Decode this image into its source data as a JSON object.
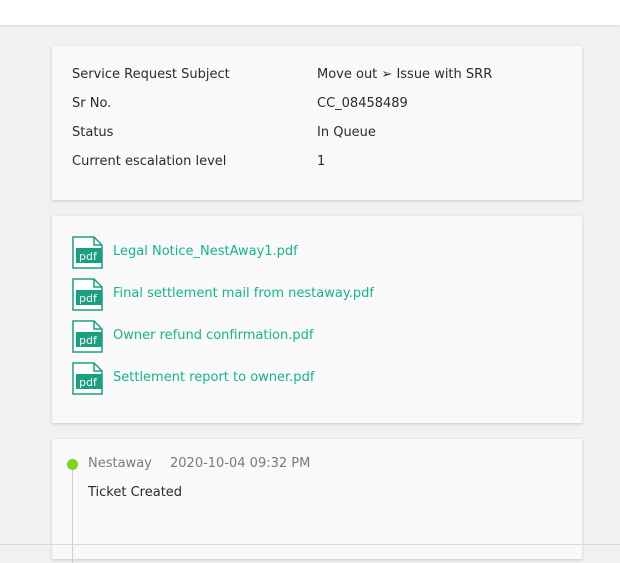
{
  "details": {
    "rows": [
      {
        "label": "Service Request Subject",
        "value": "Move out ➢ Issue with SRR"
      },
      {
        "label": "Sr No.",
        "value": "CC_08458489"
      },
      {
        "label": "Status",
        "value": "In Queue"
      },
      {
        "label": "Current escalation level",
        "value": "1"
      }
    ]
  },
  "attachments": {
    "icon_text": "pdf",
    "icon": "pdf-file-icon",
    "link_color": "#15b58b",
    "files": [
      {
        "name": "Legal Notice_NestAway1.pdf"
      },
      {
        "name": "Final settlement mail from nestaway.pdf"
      },
      {
        "name": "Owner refund confirmation.pdf"
      },
      {
        "name": "Settlement report to owner.pdf"
      }
    ]
  },
  "timeline": {
    "dot_color": "#7ed321",
    "events": [
      {
        "author": "Nestaway",
        "time": "2020-10-04 09:32 PM",
        "text": "Ticket Created"
      }
    ]
  }
}
